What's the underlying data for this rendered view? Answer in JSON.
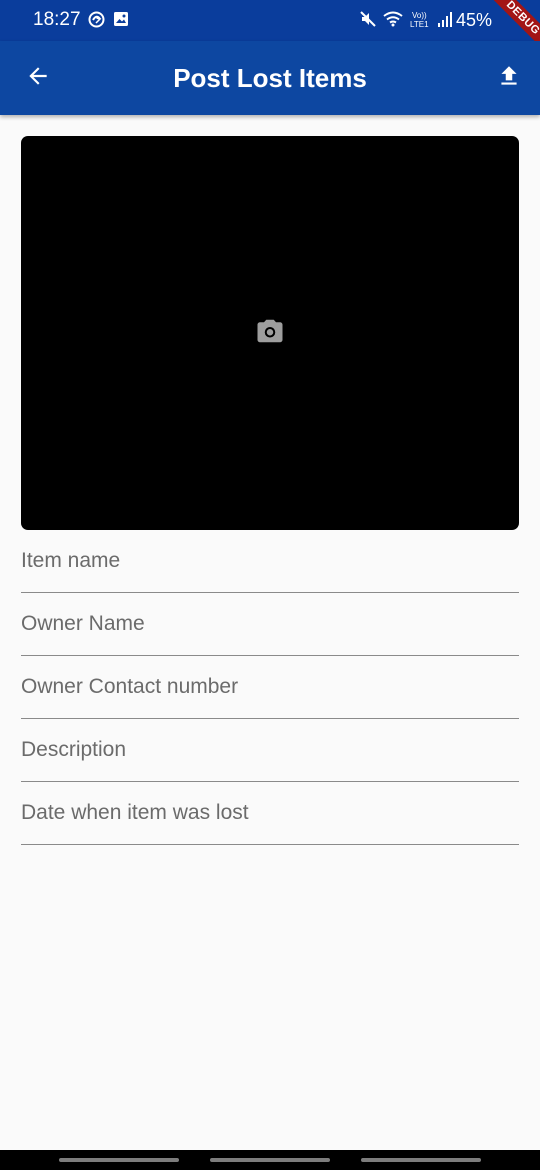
{
  "status_bar": {
    "time": "18:27",
    "battery": "45%",
    "left_icons": [
      "sync-icon",
      "image-icon"
    ],
    "right_icons": [
      "mute-icon",
      "wifi-icon",
      "volte-icon",
      "signal-icon"
    ],
    "volte_label": "Vo))\nLTE1"
  },
  "debug_banner": "DEBUG",
  "app_bar": {
    "title": "Post Lost Items",
    "back_icon": "arrow-left-icon",
    "upload_icon": "upload-icon",
    "background": "#0d47a1"
  },
  "image_picker": {
    "icon": "camera-icon",
    "background": "#000000"
  },
  "form": {
    "fields": [
      {
        "label": "Item name"
      },
      {
        "label": "Owner Name"
      },
      {
        "label": "Owner Contact number"
      },
      {
        "label": "Description"
      },
      {
        "label": "Date when item was lost"
      }
    ]
  }
}
